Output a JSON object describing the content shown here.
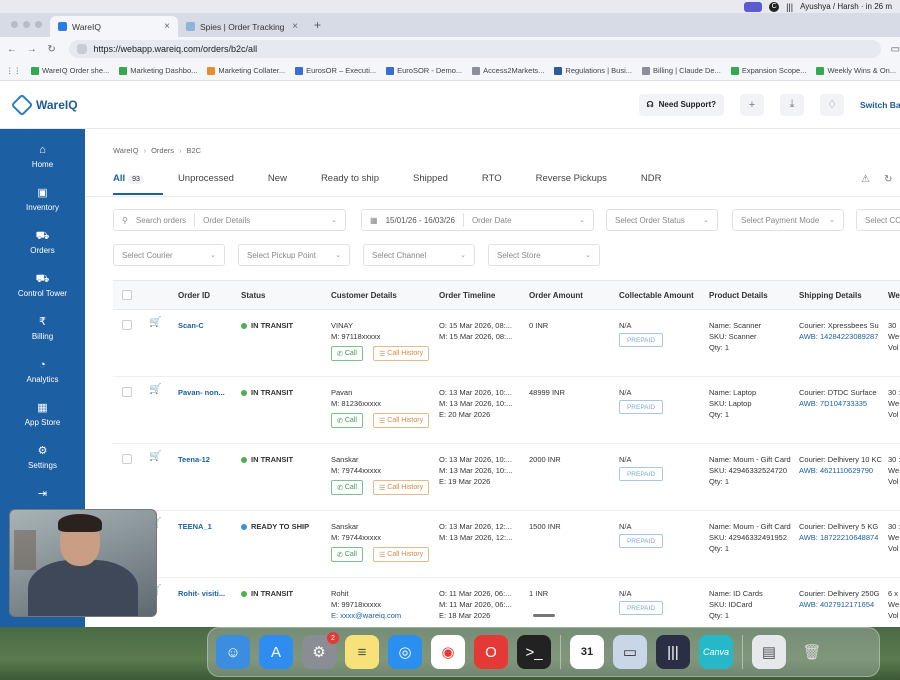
{
  "menubar": {
    "status": "Ayushya / Harsh · in 26 m"
  },
  "browser": {
    "tabs": [
      {
        "label": "WareIQ",
        "active": true
      },
      {
        "label": "Spies | Order Tracking",
        "active": false
      }
    ],
    "url": "https://webapp.wareiq.com/orders/b2c/all",
    "bookmarks": [
      "WareIQ Order she...",
      "Marketing Dashbo...",
      "Marketing Collater...",
      "EurosOR – Executi...",
      "EuroSOR - Demo...",
      "Access2Markets...",
      "Regulations | Busi...",
      "Billing | Claude De...",
      "Expansion Scope...",
      "Weekly Wins & On..."
    ]
  },
  "header": {
    "logo": "WareIQ",
    "support": "Need Support?",
    "switch": "Switch Ba"
  },
  "sidebar": [
    {
      "label": "Home",
      "icon": "home-icon"
    },
    {
      "label": "Inventory",
      "icon": "box-icon"
    },
    {
      "label": "Orders",
      "icon": "cart-icon"
    },
    {
      "label": "Control Tower",
      "icon": "truck-icon"
    },
    {
      "label": "Billing",
      "icon": "billing-icon"
    },
    {
      "label": "Analytics",
      "icon": "analytics-icon"
    },
    {
      "label": "App Store",
      "icon": "grid-icon"
    },
    {
      "label": "Settings",
      "icon": "gear-icon"
    }
  ],
  "breadcrumb": [
    "WareIQ",
    "Orders",
    "B2C"
  ],
  "tabs": [
    {
      "label": "All",
      "count": "93"
    },
    {
      "label": "Unprocessed"
    },
    {
      "label": "New"
    },
    {
      "label": "Ready to ship"
    },
    {
      "label": "Shipped"
    },
    {
      "label": "RTO"
    },
    {
      "label": "Reverse Pickups"
    },
    {
      "label": "NDR"
    }
  ],
  "filters": {
    "search_placeholder": "Search orders",
    "order_details": "Order Details",
    "date_range": "15/01/26 - 16/03/26",
    "order_date": "Order Date",
    "order_status": "Select Order Status",
    "payment_mode": "Select Payment Mode",
    "cod": "Select CO",
    "courier": "Select Courier",
    "pickup": "Select Pickup Point",
    "channel": "Select Channel",
    "store": "Select Store"
  },
  "table": {
    "headers": [
      "Order ID",
      "Status",
      "Customer Details",
      "Order Timeline",
      "Order Amount",
      "Collectable Amount",
      "Product Details",
      "Shipping Details",
      "We"
    ],
    "call_label": "Call",
    "history_label": "Call History",
    "prepaid_label": "PREPAID",
    "rows": [
      {
        "order_id": "Scan-C",
        "status": "IN TRANSIT",
        "status_color": "green",
        "customer": "VINAY",
        "mobile": "M: 97118xxxxx",
        "email": "",
        "timeline": [
          "O: 15 Mar 2026, 08:...",
          "M: 15 Mar 2026, 08:..."
        ],
        "amount": "0 INR",
        "collectable": "N/A",
        "product": [
          "Name: Scanner",
          "SKU: Scanner",
          "Qty: 1"
        ],
        "shipping": [
          "Courier: Xpressbees Su",
          "AWB: 14284223089287"
        ],
        "weight": [
          "30",
          "We",
          "Vol"
        ]
      },
      {
        "order_id": "Pavan- non...",
        "status": "IN TRANSIT",
        "status_color": "green",
        "customer": "Pavan",
        "mobile": "M: 81236xxxxx",
        "email": "",
        "timeline": [
          "O: 13 Mar 2026, 10:...",
          "M: 13 Mar 2026, 10:...",
          "E: 20 Mar 2026"
        ],
        "amount": "48999 INR",
        "collectable": "N/A",
        "product": [
          "Name: Laptop",
          "SKU: Laptop",
          "Qty: 1"
        ],
        "shipping": [
          "Courier: DTDC Surface",
          "AWB: 7D104733335"
        ],
        "weight": [
          "30 :",
          "We",
          "Vol"
        ]
      },
      {
        "order_id": "Teena-12",
        "status": "IN TRANSIT",
        "status_color": "green",
        "customer": "Sanskar",
        "mobile": "M: 79744xxxxx",
        "email": "",
        "timeline": [
          "O: 13 Mar 2026, 10:...",
          "M: 13 Mar 2026, 10:...",
          "E: 19 Mar 2026"
        ],
        "amount": "2000 INR",
        "collectable": "N/A",
        "product": [
          "Name: Moum - Gift Card",
          "SKU: 42946332524720",
          "Qty: 1"
        ],
        "shipping": [
          "Courier: Delhivery 10 KC",
          "AWB: 4621110629790"
        ],
        "weight": [
          "30 :",
          "We",
          "Vol"
        ]
      },
      {
        "order_id": "TEENA_1",
        "status": "READY TO SHIP",
        "status_color": "blue",
        "customer": "Sanskar",
        "mobile": "M: 79744xxxxx",
        "email": "",
        "timeline": [
          "O: 13 Mar 2026, 12:...",
          "M: 13 Mar 2026, 12:..."
        ],
        "amount": "1500 INR",
        "collectable": "N/A",
        "product": [
          "Name: Moum - Gift Card",
          "SKU: 42946332491952",
          "Qty: 1"
        ],
        "shipping": [
          "Courier: Delhivery 5 KG",
          "AWB: 18722210648874"
        ],
        "weight": [
          "30 :",
          "We",
          "Vol"
        ]
      },
      {
        "order_id": "Rohit- visiti...",
        "status": "IN TRANSIT",
        "status_color": "green",
        "customer": "Rohit",
        "mobile": "M: 99718xxxxx",
        "email": "E: xxxx@wareiq.com",
        "timeline": [
          "O: 11 Mar 2026, 06:...",
          "M: 11 Mar 2026, 06:...",
          "E: 18 Mar 2026"
        ],
        "amount": "1 INR",
        "collectable": "N/A",
        "product": [
          "Name: ID Cards",
          "SKU: IDCard",
          "Qty: 1"
        ],
        "shipping": [
          "Courier: Delhivery 250G",
          "AWB: 4027912171654"
        ],
        "weight": [
          "6 x",
          "We",
          "Vol"
        ]
      }
    ]
  },
  "dock": {
    "settings_badge": "2",
    "calendar_day": "31"
  },
  "colors": {
    "brand": "#1d5fa3",
    "in_transit": "#4caf50",
    "ready": "#3b8fe0"
  }
}
